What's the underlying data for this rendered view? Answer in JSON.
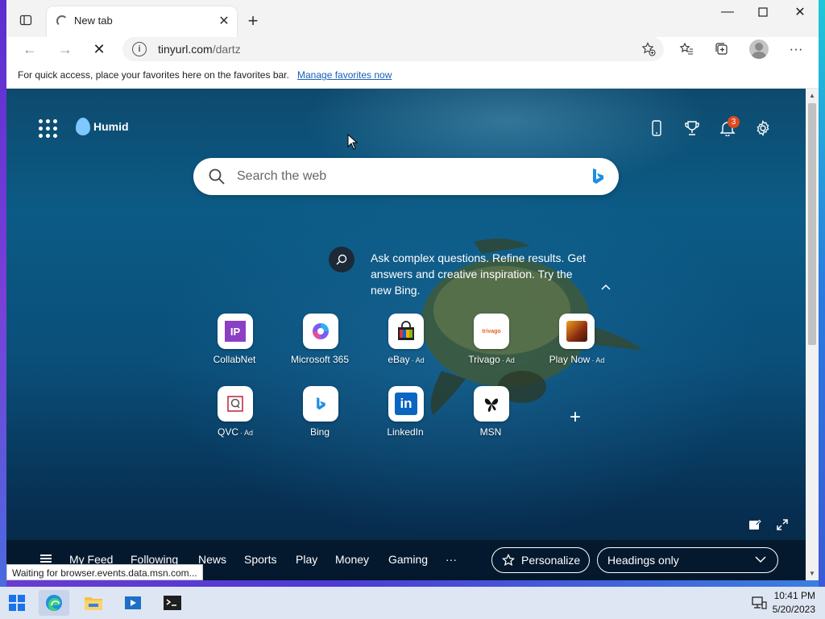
{
  "browser": {
    "tab_title": "New tab",
    "url_host": "tinyurl.com",
    "url_path": "/dartz",
    "favorites_message": "For quick access, place your favorites here on the favorites bar.",
    "favorites_link": "Manage favorites now"
  },
  "page": {
    "weather_label": "Humid",
    "notification_count": "3",
    "search_placeholder": "Search the web",
    "ask_text": "Ask complex questions. Refine results. Get answers and creative inspiration. Try the new Bing.",
    "tiles": [
      {
        "label": "CollabNet",
        "ad": ""
      },
      {
        "label": "Microsoft 365",
        "ad": ""
      },
      {
        "label": "eBay",
        "ad": "· Ad"
      },
      {
        "label": "Trivago",
        "ad": "· Ad"
      },
      {
        "label": "Play Now",
        "ad": "· Ad"
      },
      {
        "label": "QVC",
        "ad": "· Ad"
      },
      {
        "label": "Bing",
        "ad": ""
      },
      {
        "label": "LinkedIn",
        "ad": ""
      },
      {
        "label": "MSN",
        "ad": ""
      }
    ],
    "tile_icon_text": {
      "collabnet": "IP",
      "linkedin": "in",
      "trivago": "trivago"
    },
    "feed_nav": [
      "My Feed",
      "Following",
      "News",
      "Sports",
      "Play",
      "Money",
      "Gaming",
      "···"
    ],
    "personalize_label": "Personalize",
    "headings_label": "Headings only",
    "status_text": "Waiting for browser.events.data.msn.com..."
  },
  "taskbar": {
    "time": "10:41 PM",
    "date": "5/20/2023"
  },
  "colors": {
    "accent": "#1a5fb4",
    "badge": "#e0481c"
  }
}
